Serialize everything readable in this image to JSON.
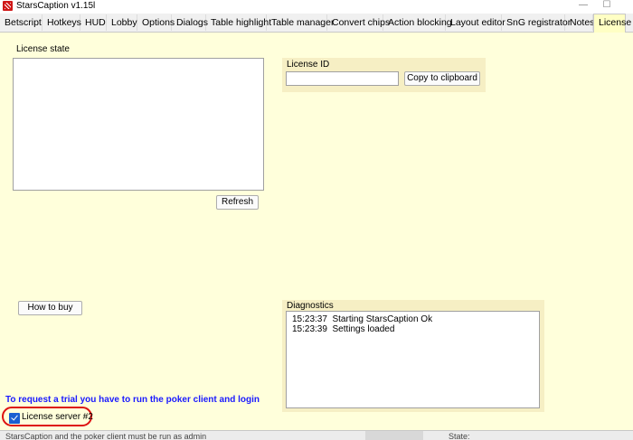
{
  "window": {
    "title": "StarsCaption v1.15l",
    "maximize_glyph": "☐"
  },
  "tabs": [
    {
      "label": "Betscript"
    },
    {
      "label": "Hotkeys"
    },
    {
      "label": "HUD"
    },
    {
      "label": "Lobby"
    },
    {
      "label": "Options"
    },
    {
      "label": "Dialogs"
    },
    {
      "label": "Table highlight"
    },
    {
      "label": "Table manager"
    },
    {
      "label": "Convert chips"
    },
    {
      "label": "Action blocking"
    },
    {
      "label": "Layout editor"
    },
    {
      "label": "SnG registrator"
    },
    {
      "label": "Notes"
    },
    {
      "label": "License",
      "active": true
    }
  ],
  "license_state": {
    "label": "License state",
    "refresh_button": "Refresh"
  },
  "license_id": {
    "label": "License ID",
    "value": "",
    "copy_button": "Copy to clipboard"
  },
  "how_to_buy_button": "How to buy",
  "diagnostics": {
    "label": "Diagnostics",
    "lines": [
      "15:23:37  Starting StarsCaption Ok",
      "15:23:39  Settings loaded"
    ]
  },
  "trial_notice": "To request a trial you have to run the poker client and login",
  "license_server": {
    "label": "License server #2",
    "checked": true
  },
  "statusbar": {
    "left_text": "StarsCaption and the poker client must be run as admin",
    "right_text": "State:"
  },
  "colors": {
    "panel_bg": "#ffffdb",
    "group_bg": "#f6efc4",
    "trial_text": "#1a1aff",
    "checkbox": "#1a5fd1",
    "highlight_oval": "#dd1111"
  }
}
